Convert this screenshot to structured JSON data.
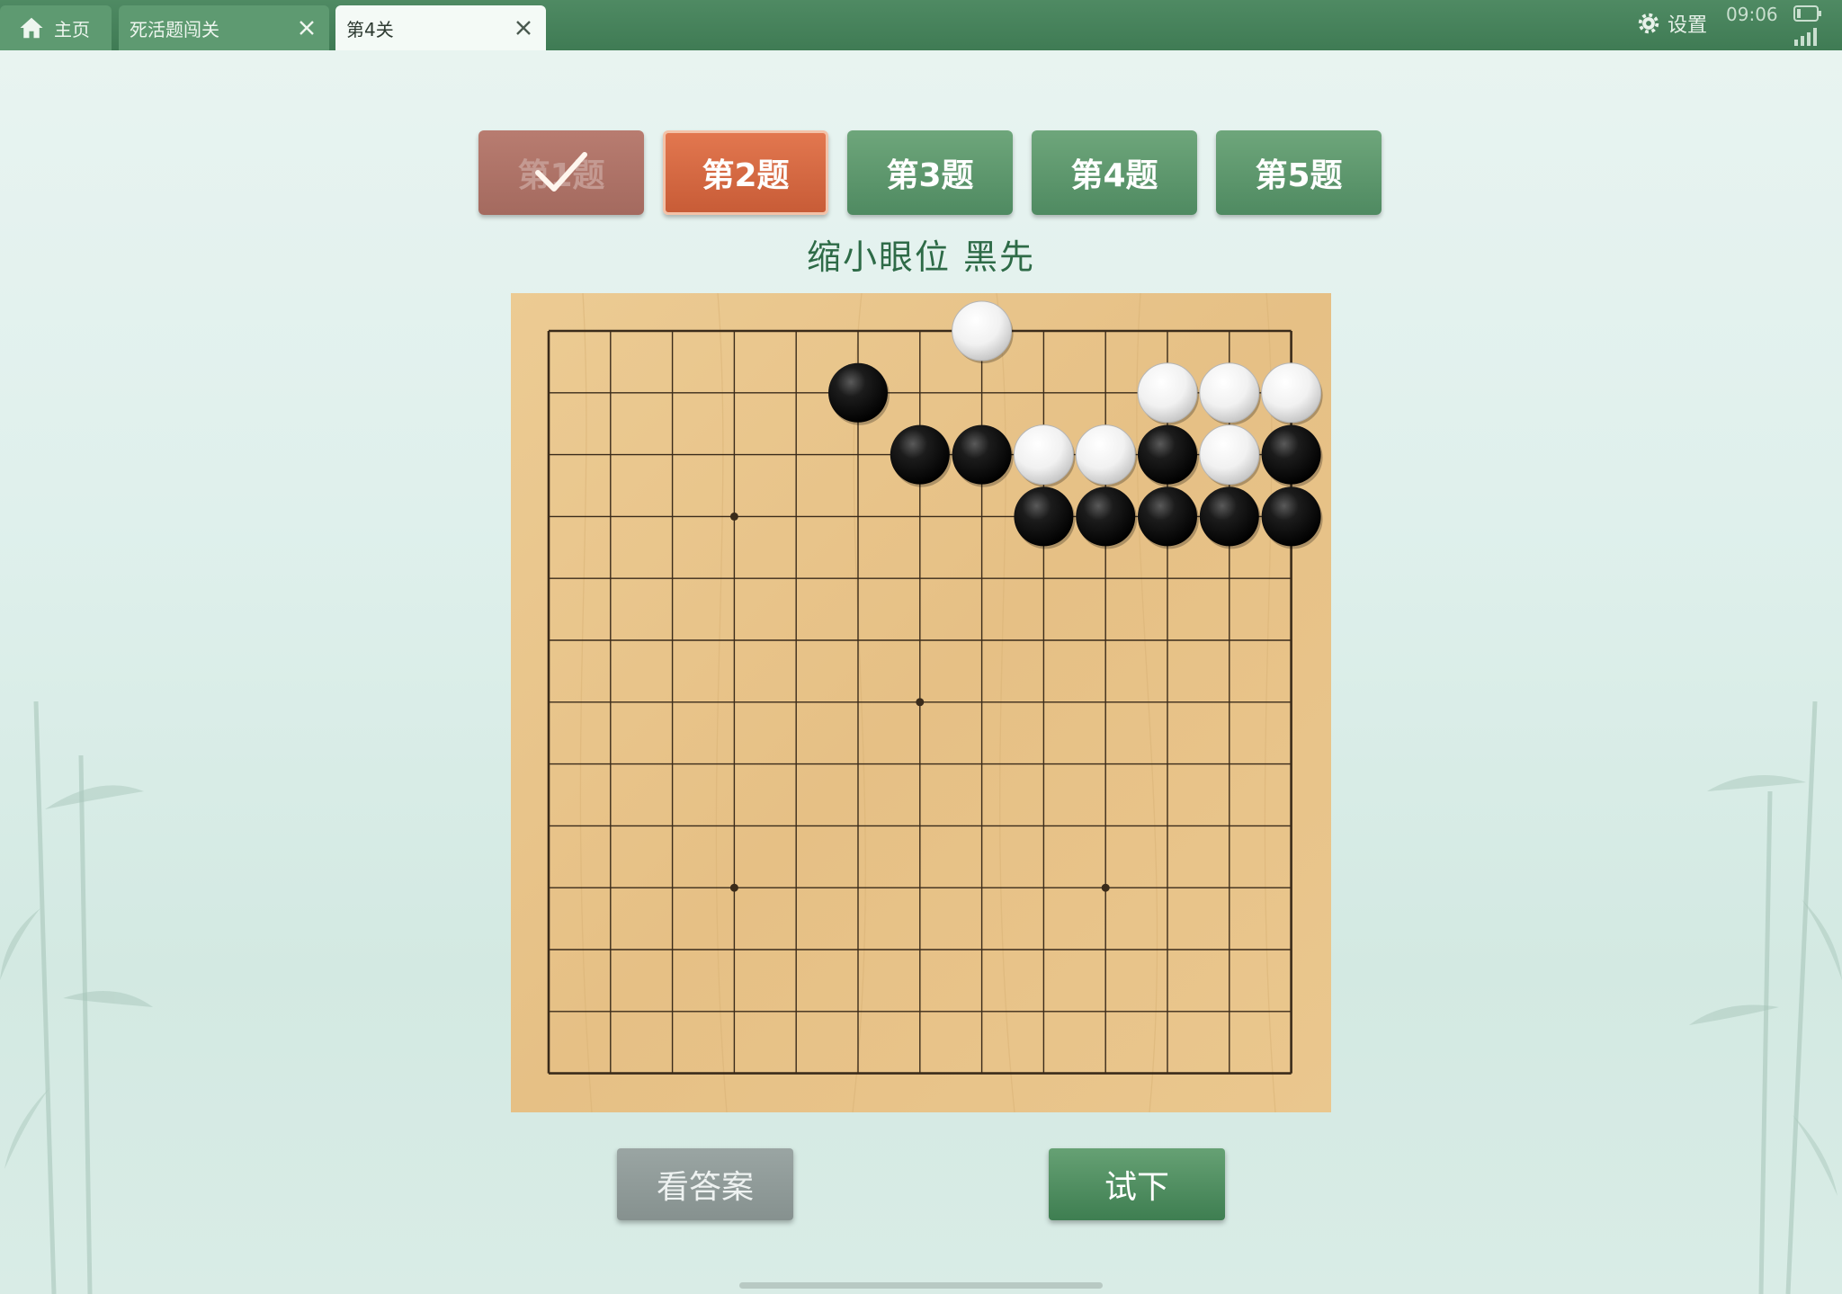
{
  "tabs": [
    {
      "label": "主页",
      "icon": "home-icon"
    },
    {
      "label": "死活题闯关",
      "icon": "close-icon"
    },
    {
      "label": "第4关",
      "icon": "close-icon",
      "active": true
    }
  ],
  "status": {
    "settings_label": "设置",
    "time": "09:06"
  },
  "problems": [
    {
      "label": "第1题",
      "state": "done"
    },
    {
      "label": "第2题",
      "state": "current"
    },
    {
      "label": "第3题",
      "state": "normal"
    },
    {
      "label": "第4题",
      "state": "normal"
    },
    {
      "label": "第5题",
      "state": "normal"
    }
  ],
  "subtitle": "缩小眼位   黑先",
  "board": {
    "size": 13,
    "star_points": [
      [
        3,
        3
      ],
      [
        6,
        6
      ],
      [
        3,
        9
      ],
      [
        9,
        9
      ]
    ],
    "stones": [
      {
        "c": 7,
        "r": 0,
        "color": "white"
      },
      {
        "c": 5,
        "r": 1,
        "color": "black"
      },
      {
        "c": 10,
        "r": 1,
        "color": "white"
      },
      {
        "c": 11,
        "r": 1,
        "color": "white"
      },
      {
        "c": 12,
        "r": 1,
        "color": "white"
      },
      {
        "c": 6,
        "r": 2,
        "color": "black"
      },
      {
        "c": 7,
        "r": 2,
        "color": "black"
      },
      {
        "c": 8,
        "r": 2,
        "color": "white"
      },
      {
        "c": 9,
        "r": 2,
        "color": "white"
      },
      {
        "c": 10,
        "r": 2,
        "color": "black"
      },
      {
        "c": 11,
        "r": 2,
        "color": "white"
      },
      {
        "c": 12,
        "r": 2,
        "color": "black"
      },
      {
        "c": 8,
        "r": 3,
        "color": "black"
      },
      {
        "c": 9,
        "r": 3,
        "color": "black"
      },
      {
        "c": 10,
        "r": 3,
        "color": "black"
      },
      {
        "c": 11,
        "r": 3,
        "color": "black"
      },
      {
        "c": 12,
        "r": 3,
        "color": "black"
      }
    ]
  },
  "buttons": {
    "answer": "看答案",
    "try": "试下"
  },
  "colors": {
    "topbar": "#3f7b54",
    "board_wood": "#e8c48a",
    "current_problem": "#d0653f",
    "done_problem": "#a8706a",
    "green_button": "#4f8a61"
  }
}
